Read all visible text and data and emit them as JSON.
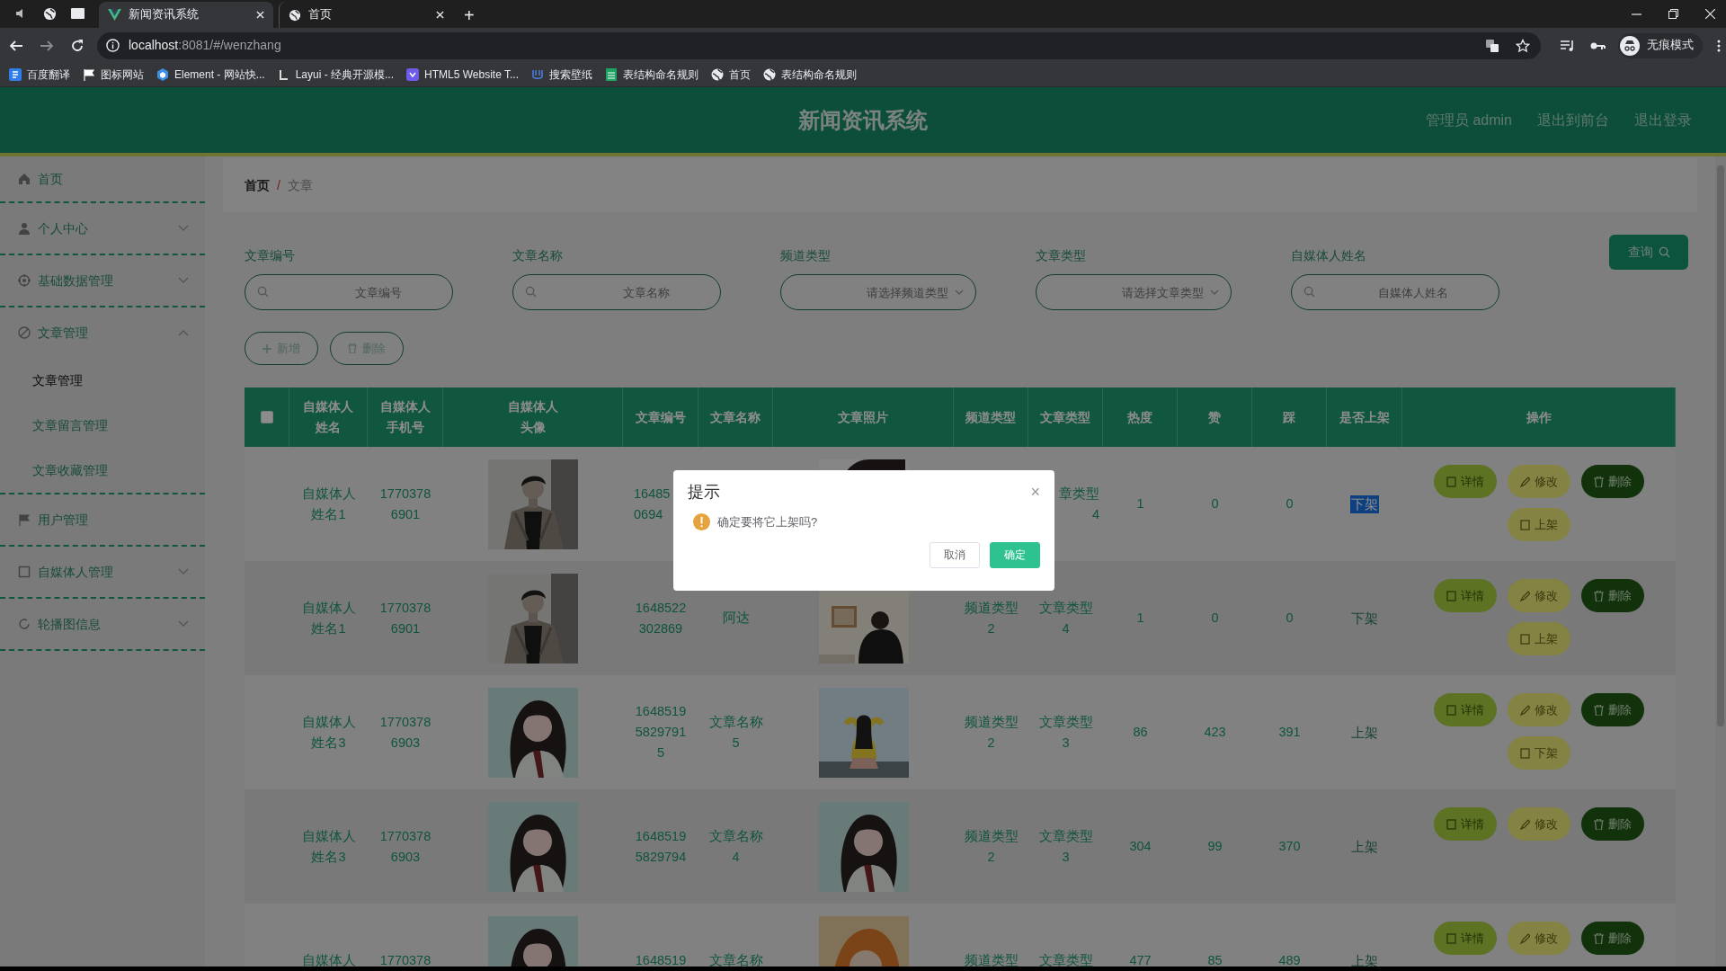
{
  "browser": {
    "tabs": [
      {
        "title": "新闻资讯系统",
        "selected": true
      },
      {
        "title": "首页",
        "selected": false
      }
    ],
    "new_tab": "+",
    "url_host": "localhost",
    "url_path": ":8081/#/wenzhang",
    "profile": "无痕模式",
    "bookmarks": [
      "百度翻译",
      "图标网站",
      "Element - 网站快...",
      "Layui - 经典开源模...",
      "HTML5 Website T...",
      "搜索壁纸",
      "表结构命名规则",
      "首页",
      "表结构命名规则"
    ]
  },
  "header": {
    "title": "新闻资讯系统",
    "user": "管理员 admin",
    "links": [
      "退出到前台",
      "退出登录"
    ]
  },
  "sidebar": {
    "items": [
      {
        "label": "首页",
        "submenu": false
      },
      {
        "label": "个人中心",
        "submenu": true,
        "expanded": false
      },
      {
        "label": "基础数据管理",
        "submenu": true,
        "expanded": false
      },
      {
        "label": "文章管理",
        "submenu": true,
        "expanded": true,
        "children": [
          {
            "label": "文章管理",
            "selected": true
          },
          {
            "label": "文章留言管理",
            "selected": false
          },
          {
            "label": "文章收藏管理",
            "selected": false
          }
        ]
      },
      {
        "label": "用户管理",
        "submenu": false
      },
      {
        "label": "自媒体人管理",
        "submenu": true,
        "expanded": false
      },
      {
        "label": "轮播图信息",
        "submenu": true,
        "expanded": false
      }
    ]
  },
  "breadcrumb": [
    "首页",
    "文章"
  ],
  "breadcrumb_separator": "/",
  "filters": [
    {
      "label": "文章编号",
      "kind": "input",
      "placeholder": "文章编号"
    },
    {
      "label": "文章名称",
      "kind": "input",
      "placeholder": "文章名称"
    },
    {
      "label": "频道类型",
      "kind": "select",
      "placeholder": "请选择频道类型"
    },
    {
      "label": "文章类型",
      "kind": "select",
      "placeholder": "请选择文章类型"
    },
    {
      "label": "自媒体人姓名",
      "kind": "input",
      "placeholder": "自媒体人姓名"
    }
  ],
  "search_button": "查询",
  "toolbar": [
    {
      "kind": "add",
      "label": "新增"
    },
    {
      "kind": "delete",
      "label": "删除"
    }
  ],
  "table": {
    "columns": [
      {
        "kind": "checkbox",
        "checked": false
      },
      {
        "kind": "text",
        "label": "自媒体人姓名"
      },
      {
        "kind": "text",
        "label": "自媒体人手机号"
      },
      {
        "kind": "text",
        "label": "自媒体人头像"
      },
      {
        "kind": "text",
        "label": "文章编号"
      },
      {
        "kind": "text",
        "label": "文章名称"
      },
      {
        "kind": "text",
        "label": "文章照片"
      },
      {
        "kind": "text",
        "label": "频道类型"
      },
      {
        "kind": "text",
        "label": "文章类型"
      },
      {
        "kind": "text",
        "label": "热度"
      },
      {
        "kind": "text",
        "label": "赞"
      },
      {
        "kind": "text",
        "label": "踩"
      },
      {
        "kind": "text",
        "label": "是否上架"
      },
      {
        "kind": "text",
        "label": "操作"
      }
    ],
    "rows": [
      {
        "name": "自媒体人姓名1",
        "phone": "17703786901",
        "avatar": {
          "kind": "picture"
        },
        "article_id": {
          "text": "16485 0694",
          "covered_right": true
        },
        "photo": {
          "kind": "picture"
        },
        "article_type": {
          "text": "章类型 4",
          "covered_left": true
        },
        "heat": "1",
        "likes": "0",
        "dislikes": "0",
        "status": {
          "text": "下架",
          "highlighted": true
        },
        "actions": [
          {
            "kind": "detail",
            "label": "详情"
          },
          {
            "kind": "edit",
            "label": "修改"
          },
          {
            "kind": "delete",
            "label": "删除"
          },
          {
            "kind": "toggle",
            "label": "上架"
          }
        ]
      },
      {
        "name": "自媒体人姓名1",
        "phone": "17703786901",
        "avatar": {
          "kind": "picture"
        },
        "article_id": "1648522302869",
        "title": "阿达",
        "photo": {
          "kind": "picture"
        },
        "channel": "频道类型2",
        "article_type": "文章类型4",
        "heat": "1",
        "likes": "0",
        "dislikes": "0",
        "status": {
          "text": "下架",
          "highlighted": false
        },
        "actions": [
          {
            "kind": "detail",
            "label": "详情"
          },
          {
            "kind": "edit",
            "label": "修改"
          },
          {
            "kind": "delete",
            "label": "删除"
          },
          {
            "kind": "toggle",
            "label": "上架"
          }
        ]
      },
      {
        "name": "自媒体人姓名3",
        "phone": "17703786903",
        "avatar": {
          "kind": "picture"
        },
        "article_id": "164851958297915",
        "title": "文章名称5",
        "photo": {
          "kind": "picture"
        },
        "channel": "频道类型2",
        "article_type": "文章类型3",
        "heat": "86",
        "likes": "423",
        "dislikes": "391",
        "status": {
          "text": "上架",
          "highlighted": false
        },
        "actions": [
          {
            "kind": "detail",
            "label": "详情"
          },
          {
            "kind": "edit",
            "label": "修改"
          },
          {
            "kind": "delete",
            "label": "删除"
          },
          {
            "kind": "toggle",
            "label": "下架"
          }
        ]
      },
      {
        "name": "自媒体人姓名3",
        "phone": "17703786903",
        "avatar": {
          "kind": "picture"
        },
        "article_id": "16485195829794",
        "title": "文章名称4",
        "photo": {
          "kind": "picture"
        },
        "channel": "频道类型2",
        "article_type": "文章类型3",
        "heat": "304",
        "likes": "99",
        "dislikes": "370",
        "status": {
          "text": "上架",
          "highlighted": false
        },
        "actions": [
          {
            "kind": "detail",
            "label": "详情"
          },
          {
            "kind": "edit",
            "label": "修改"
          },
          {
            "kind": "delete",
            "label": "删除"
          }
        ]
      },
      {
        "name": "自媒体人",
        "phone": "1770378",
        "avatar": {
          "kind": "picture"
        },
        "article_id": "1648519",
        "title": "文章名称",
        "photo": {
          "kind": "picture"
        },
        "channel": "频道类型",
        "article_type": "文章类型",
        "heat": "477",
        "likes": "85",
        "dislikes": "489",
        "status": {
          "text": "上架",
          "highlighted": false
        },
        "actions": [
          {
            "kind": "detail",
            "label": "详情"
          },
          {
            "kind": "edit",
            "label": "修改"
          },
          {
            "kind": "delete",
            "label": "删除"
          }
        ]
      }
    ]
  },
  "dialog": {
    "title": "提示",
    "close": "×",
    "message": "确定要将它上架吗?",
    "buttons": [
      {
        "kind": "cancel",
        "label": "取消"
      },
      {
        "kind": "confirm",
        "label": "确定"
      }
    ]
  }
}
